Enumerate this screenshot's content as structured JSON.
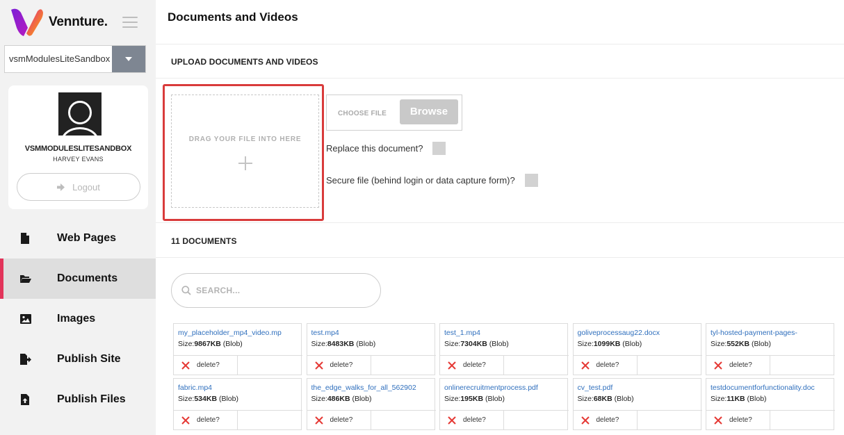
{
  "brand": {
    "name": "Vennture.",
    "logo_colors": [
      "#7b1fd6",
      "#e0218a",
      "#ffb000"
    ]
  },
  "site_selector": {
    "value": "vsmModulesLiteSandbox"
  },
  "profile": {
    "site_name": "VSMMODULESLITESANDBOX",
    "user_name": "HARVEY EVANS",
    "logout_label": "Logout"
  },
  "nav": {
    "items": [
      {
        "label": "Web Pages",
        "icon": "file-icon",
        "active": false
      },
      {
        "label": "Documents",
        "icon": "folder-open-icon",
        "active": true
      },
      {
        "label": "Images",
        "icon": "image-icon",
        "active": false
      },
      {
        "label": "Publish Site",
        "icon": "file-export-icon",
        "active": false
      },
      {
        "label": "Publish Files",
        "icon": "file-upload-icon",
        "active": false
      }
    ]
  },
  "main": {
    "title": "Documents and Videos",
    "upload": {
      "heading": "UPLOAD DOCUMENTS AND VIDEOS",
      "drop_text": "DRAG YOUR FILE INTO HERE",
      "choose_file_label": "CHOOSE FILE",
      "browse_label": "Browse",
      "replace_label": "Replace this document?",
      "secure_label": "Secure file (behind login or data capture form)?"
    },
    "documents": {
      "heading": "11 DOCUMENTS",
      "search_placeholder": "SEARCH...",
      "delete_label": "delete?",
      "size_prefix": "Size:",
      "size_unit": "KB",
      "storage": " (Blob)",
      "items": [
        {
          "name": "my_placeholder_mp4_video.mp",
          "size": "9867"
        },
        {
          "name": "test.mp4",
          "size": "8483"
        },
        {
          "name": "test_1.mp4",
          "size": "7304"
        },
        {
          "name": "goliveprocessaug22.docx",
          "size": "1099"
        },
        {
          "name": "tyl-hosted-payment-pages-",
          "size": "552"
        },
        {
          "name": "fabric.mp4",
          "size": "534"
        },
        {
          "name": "the_edge_walks_for_all_562902",
          "size": "486"
        },
        {
          "name": "onlinerecruitmentprocess.pdf",
          "size": "195"
        },
        {
          "name": "cv_test.pdf",
          "size": "68"
        },
        {
          "name": "testdocumentforfunctionality.doc",
          "size": "11"
        }
      ]
    }
  },
  "colors": {
    "accent": "#e2345a",
    "highlight_border": "#d93b3b",
    "link": "#2f6fbd",
    "delete": "#e53935"
  }
}
